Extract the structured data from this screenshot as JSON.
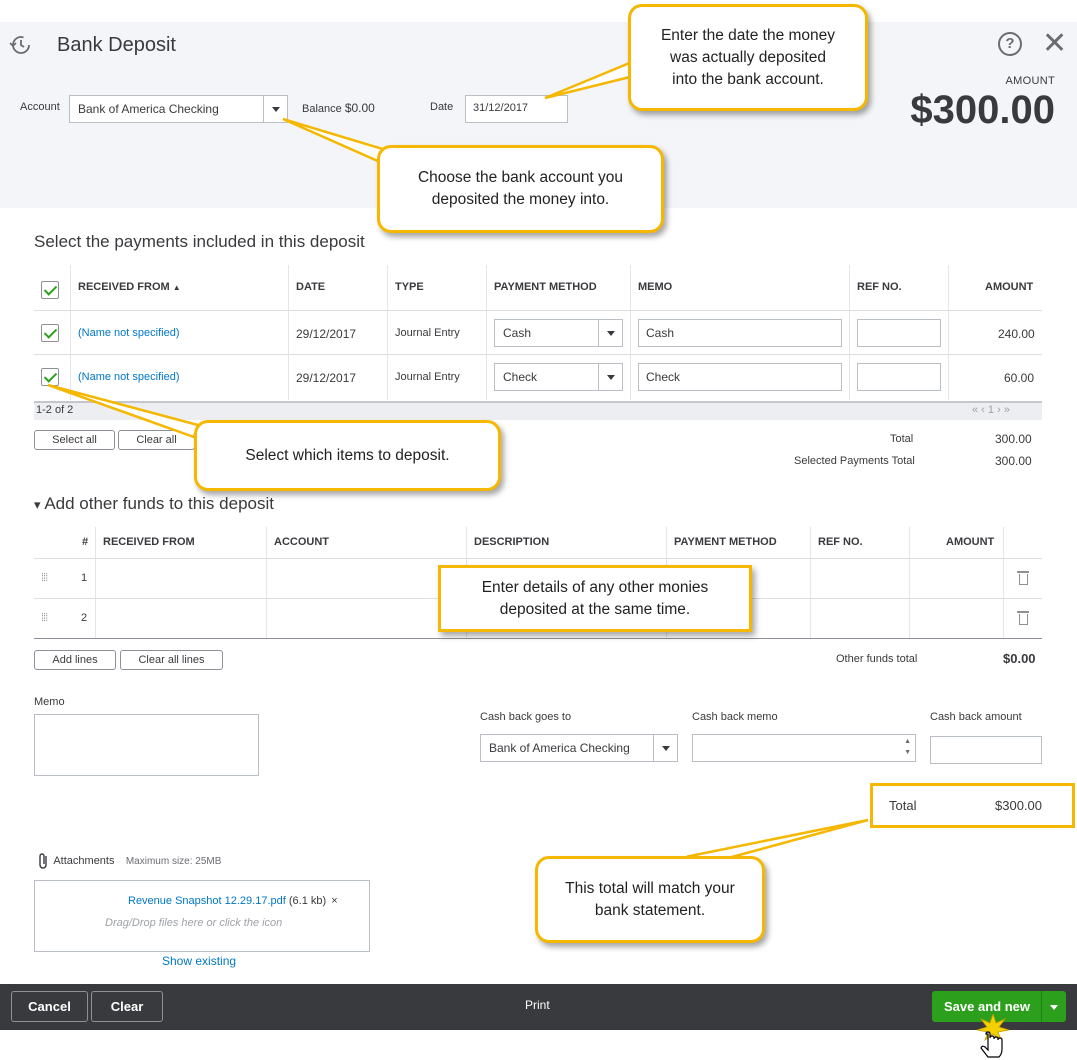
{
  "header": {
    "title": "Bank Deposit",
    "account_label": "Account",
    "account_value": "Bank of America Checking",
    "balance_label": "Balance",
    "balance_value": "$0.00",
    "date_label": "Date",
    "date_value": "31/12/2017",
    "amount_label": "AMOUNT",
    "amount_value": "$300.00"
  },
  "payments": {
    "section_title": "Select the payments included in this deposit",
    "columns": [
      "RECEIVED FROM",
      "DATE",
      "TYPE",
      "PAYMENT METHOD",
      "MEMO",
      "REF NO.",
      "AMOUNT"
    ],
    "sort_indicator": "▲",
    "rows": [
      {
        "received_from": "(Name not specified)",
        "date": "29/12/2017",
        "type": "Journal Entry",
        "payment_method": "Cash",
        "memo": "Cash",
        "ref_no": "",
        "amount": "240.00",
        "checked": true
      },
      {
        "received_from": "(Name not specified)",
        "date": "29/12/2017",
        "type": "Journal Entry",
        "payment_method": "Check",
        "memo": "Check",
        "ref_no": "",
        "amount": "60.00",
        "checked": true
      }
    ],
    "pager_text": "1-2 of 2",
    "pager_controls": "« ‹ 1 › »",
    "select_all": "Select all",
    "clear_all": "Clear all",
    "total_label": "Total",
    "total_value": "300.00",
    "selected_total_label": "Selected Payments Total",
    "selected_total_value": "300.00"
  },
  "other_funds": {
    "section_title": "Add other funds to this deposit",
    "collapse_glyph": "▾",
    "columns": [
      "#",
      "RECEIVED FROM",
      "ACCOUNT",
      "DESCRIPTION",
      "PAYMENT METHOD",
      "REF NO.",
      "AMOUNT"
    ],
    "rows": [
      {
        "num": "1"
      },
      {
        "num": "2"
      }
    ],
    "add_lines": "Add lines",
    "clear_all_lines": "Clear all lines",
    "total_label": "Other funds total",
    "total_value": "$0.00"
  },
  "memo": {
    "label": "Memo"
  },
  "cash_back": {
    "goes_to_label": "Cash back goes to",
    "goes_to_value": "Bank of America Checking",
    "memo_label": "Cash back memo",
    "amount_label": "Cash back amount"
  },
  "total": {
    "label": "Total",
    "value": "$300.00"
  },
  "attachments": {
    "label": "Attachments",
    "max_size": "Maximum size: 25MB",
    "file_name": "Revenue Snapshot 12.29.17.pdf",
    "file_size": "(6.1 kb)",
    "remove_glyph": "×",
    "drop_hint": "Drag/Drop files here or click the icon",
    "show_existing": "Show existing"
  },
  "footer": {
    "cancel": "Cancel",
    "clear": "Clear",
    "print": "Print",
    "save_and_new": "Save and new"
  },
  "callouts": {
    "date": "Enter the date the money\nwas actually deposited\ninto the bank account.",
    "account": "Choose the bank account you\ndeposited the money into.",
    "items": "Select which items to deposit.",
    "other_funds": "Enter details of any other monies\ndeposited at the same time.",
    "total": "This total will match your\nbank statement."
  },
  "colors": {
    "accent_green": "#2ca01c",
    "link_blue": "#0077c5",
    "callout_border": "#f5b700",
    "footer_bg": "#393a3d"
  },
  "icons": [
    "history-icon",
    "help-icon",
    "close-icon",
    "dropdown-arrow-icon",
    "checkbox-checked-icon",
    "trash-icon",
    "drag-handle-icon",
    "paperclip-icon",
    "spinner-icon",
    "hand-cursor-icon"
  ]
}
